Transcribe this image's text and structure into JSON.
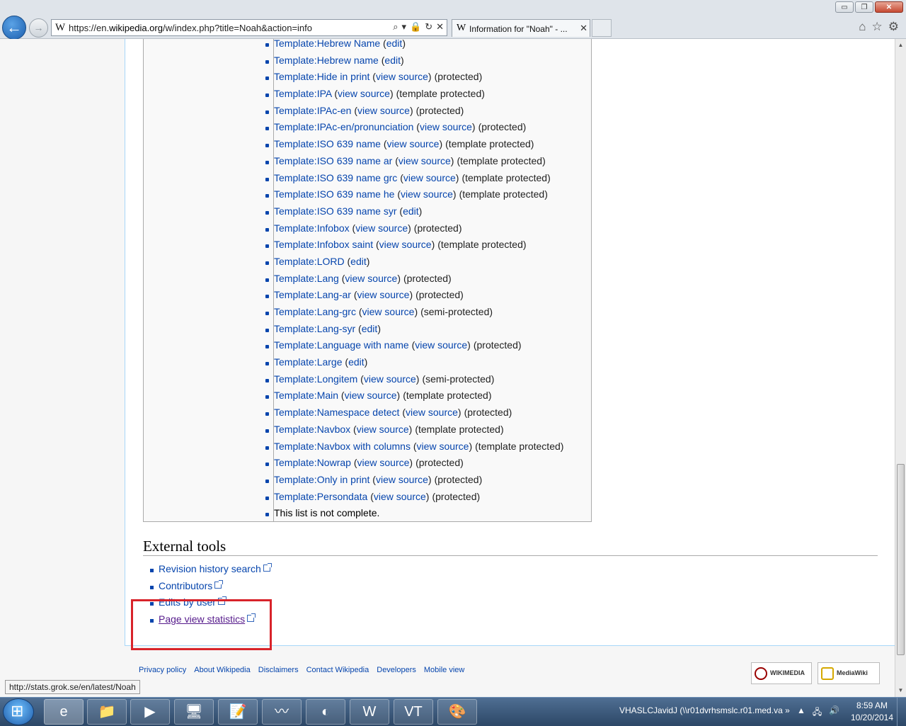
{
  "browser": {
    "url_prefix": "https://en.",
    "url_domain": "wikipedia.org",
    "url_rest": "/w/index.php?title=Noah&action=info",
    "favicon": "W",
    "addr_controls": [
      "⌕",
      "▾",
      "🔒",
      "↻",
      "✕"
    ],
    "tab_title": "Information for \"Noah\" - ...",
    "tab_close": "✕",
    "window_buttons": [
      "▭",
      "❐",
      "✕"
    ],
    "tool_icons": [
      "⌂",
      "☆",
      "⚙"
    ]
  },
  "templates": [
    {
      "name": "Template:Hebrew Name",
      "action": "edit",
      "note": ""
    },
    {
      "name": "Template:Hebrew name",
      "action": "edit",
      "note": ""
    },
    {
      "name": "Template:Hide in print",
      "action": "view source",
      "note": "(protected)"
    },
    {
      "name": "Template:IPA",
      "action": "view source",
      "note": "(template protected)"
    },
    {
      "name": "Template:IPAc-en",
      "action": "view source",
      "note": "(protected)"
    },
    {
      "name": "Template:IPAc-en/pronunciation",
      "action": "view source",
      "note": "(protected)"
    },
    {
      "name": "Template:ISO 639 name",
      "action": "view source",
      "note": "(template protected)"
    },
    {
      "name": "Template:ISO 639 name ar",
      "action": "view source",
      "note": "(template protected)"
    },
    {
      "name": "Template:ISO 639 name grc",
      "action": "view source",
      "note": "(template protected)"
    },
    {
      "name": "Template:ISO 639 name he",
      "action": "view source",
      "note": "(template protected)"
    },
    {
      "name": "Template:ISO 639 name syr",
      "action": "edit",
      "note": ""
    },
    {
      "name": "Template:Infobox",
      "action": "view source",
      "note": "(protected)"
    },
    {
      "name": "Template:Infobox saint",
      "action": "view source",
      "note": "(template protected)"
    },
    {
      "name": "Template:LORD",
      "action": "edit",
      "note": ""
    },
    {
      "name": "Template:Lang",
      "action": "view source",
      "note": "(protected)"
    },
    {
      "name": "Template:Lang-ar",
      "action": "view source",
      "note": "(protected)"
    },
    {
      "name": "Template:Lang-grc",
      "action": "view source",
      "note": "(semi-protected)"
    },
    {
      "name": "Template:Lang-syr",
      "action": "edit",
      "note": ""
    },
    {
      "name": "Template:Language with name",
      "action": "view source",
      "note": "(protected)"
    },
    {
      "name": "Template:Large",
      "action": "edit",
      "note": ""
    },
    {
      "name": "Template:Longitem",
      "action": "view source",
      "note": "(semi-protected)"
    },
    {
      "name": "Template:Main",
      "action": "view source",
      "note": "(template protected)"
    },
    {
      "name": "Template:Namespace detect",
      "action": "view source",
      "note": "(protected)"
    },
    {
      "name": "Template:Navbox",
      "action": "view source",
      "note": "(template protected)"
    },
    {
      "name": "Template:Navbox with columns",
      "action": "view source",
      "note": "(template protected)"
    },
    {
      "name": "Template:Nowrap",
      "action": "view source",
      "note": "(protected)"
    },
    {
      "name": "Template:Only in print",
      "action": "view source",
      "note": "(protected)"
    },
    {
      "name": "Template:Persondata",
      "action": "view source",
      "note": "(protected)"
    }
  ],
  "list_incomplete": "This list is not complete.",
  "external_tools": {
    "heading": "External tools",
    "items": [
      "Revision history search",
      "Contributors",
      "Edits by user",
      "Page view statistics"
    ]
  },
  "footer": {
    "links": [
      "Privacy policy",
      "About Wikipedia",
      "Disclaimers",
      "Contact Wikipedia",
      "Developers",
      "Mobile view"
    ],
    "badge_wikimedia": "WIKIMEDIA",
    "badge_mediawiki": "MediaWiki"
  },
  "status_url": "http://stats.grok.se/en/latest/Noah",
  "taskbar": {
    "apps": [
      "e",
      "📁",
      "▶",
      "🖥",
      "📝",
      "〰",
      "◐",
      "W",
      "VT",
      "🎨"
    ],
    "tray_text": "VHASLCJavidJ (\\\\r01dvrhsmslc.r01.med.va",
    "tray_more": "»",
    "tray_icons": [
      "▲",
      "🖧",
      "🔊"
    ],
    "time": "8:59 AM",
    "date": "10/20/2014"
  }
}
